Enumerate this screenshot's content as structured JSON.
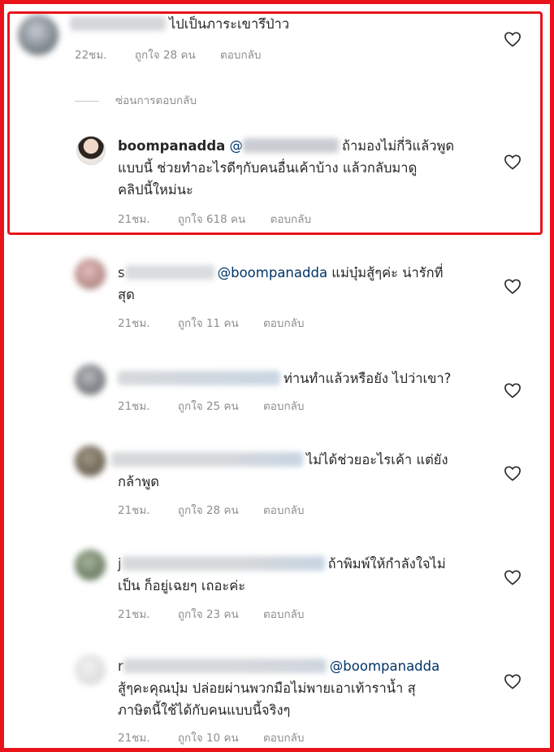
{
  "comments": [
    {
      "text": "ไปเป็นภาระเขารึป่าว",
      "time": "22ชม.",
      "likes": "ถูกใจ 28 คน",
      "reply": "ตอบกลับ"
    },
    {
      "username": "boompanadda",
      "mention": "@",
      "text": "ถ้ามองไม่กี่วิแล้วพูด",
      "text2": "แบบนี้ ช่วยทำอะไรดีๆกับคนอื่นเค้าบ้าง แล้วกลับมาดู",
      "text3": "คลิปนี้ใหม่นะ",
      "time": "21ชม.",
      "likes": "ถูกใจ 618 คน",
      "reply": "ตอบกลับ"
    },
    {
      "name_initial": "s",
      "mention": "@boompanadda",
      "text": " แม่บุ๋มสู้ๆค่ะ น่ารักที่",
      "text2": "สุด",
      "time": "21ชม.",
      "likes": "ถูกใจ 11 คน",
      "reply": "ตอบกลับ"
    },
    {
      "text": "ท่านทำแล้วหรือยัง ไปว่าเขา?",
      "time": "21ชม.",
      "likes": "ถูกใจ 25 คน",
      "reply": "ตอบกลับ"
    },
    {
      "text": "ไม่ได้ช่วยอะไรเค้า แต่ยัง",
      "text2": "กล้าพูด",
      "time": "21ชม.",
      "likes": "ถูกใจ 28 คน",
      "reply": "ตอบกลับ"
    },
    {
      "name_initial": "j",
      "text": "ถ้าพิมพ์ให้กำลังใจไม่",
      "text2": "เป็น ก็อยู่เฉยๆ เถอะค่ะ",
      "time": "21ชม.",
      "likes": "ถูกใจ 23 คน",
      "reply": "ตอบกลับ"
    },
    {
      "name_initial": "r",
      "mention": "@boompanadda",
      "text2": "สู้ๆคะคุณบุ๋ม ปล่อยผ่านพวกมือไม่พายเอาเท้าราน้ำ สุ",
      "text3": "ภาษิตนี้ใช้ได้กับคนแบบนี้จริงๆ",
      "time": "21ชม.",
      "likes": "ถูกใจ 10 คน",
      "reply": "ตอบกลับ"
    }
  ],
  "hide_replies": "ซ่อนการตอบกลับ",
  "icons": {
    "like": "heart-outline-icon"
  },
  "colors": {
    "highlight": "#e8131b",
    "mention": "#003569",
    "meta": "#8e8e8e"
  }
}
